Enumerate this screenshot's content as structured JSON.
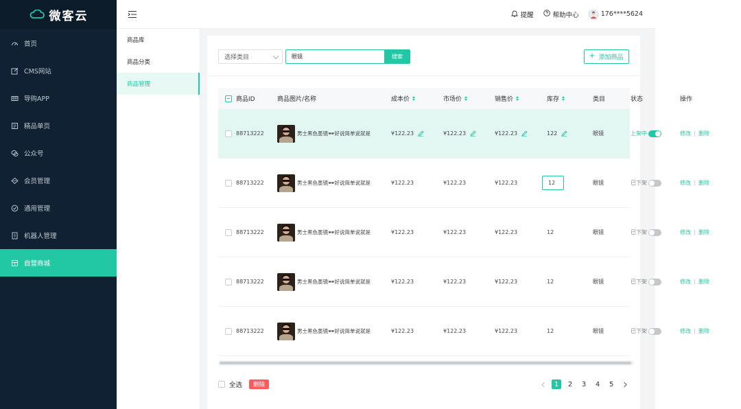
{
  "brand": {
    "name": "微客云"
  },
  "sidebar": {
    "items": [
      {
        "label": "首页",
        "icon": "dashboard-icon"
      },
      {
        "label": "CMS网站",
        "icon": "edit-icon"
      },
      {
        "label": "导购APP",
        "icon": "cart-icon"
      },
      {
        "label": "精品单页",
        "icon": "page-icon"
      },
      {
        "label": "公众号",
        "icon": "wechat-icon"
      },
      {
        "label": "会员管理",
        "icon": "member-icon"
      },
      {
        "label": "通用管理",
        "icon": "check-circle-icon"
      },
      {
        "label": "机器人管理",
        "icon": "robot-icon"
      },
      {
        "label": "自营商城",
        "icon": "shop-icon",
        "active": true
      }
    ]
  },
  "header": {
    "reminder": "提醒",
    "help": "帮助中心",
    "user": "176****5624"
  },
  "submenu": {
    "items": [
      {
        "label": "商品库"
      },
      {
        "label": "商品分类"
      },
      {
        "label": "商品管理",
        "active": true
      }
    ]
  },
  "toolbar": {
    "category_select": "选择类目",
    "search_value": "眼镜",
    "search_button": "搜索",
    "add_button": "添加商品"
  },
  "table": {
    "columns": {
      "id": "商品ID",
      "name": "商品图片/名称",
      "cost": "成本价",
      "market": "市场价",
      "sale": "销售价",
      "stock": "库存",
      "category": "类目",
      "status": "状态",
      "ops": "操作"
    },
    "rows": [
      {
        "id": "88713222",
        "name": "男士黑色墨镜🕶好说简单说就是",
        "cost": "¥122.23",
        "market": "¥122.23",
        "sale": "¥122.23",
        "stock": "122",
        "category": "眼镜",
        "status": "上架中",
        "on": true
      },
      {
        "id": "88713222",
        "name": "男士黑色墨镜🕶好说简单说就是",
        "cost": "¥122.23",
        "market": "¥122.23",
        "sale": "¥122.23",
        "stock": "12",
        "category": "眼镜",
        "status": "已下架",
        "on": false
      },
      {
        "id": "88713222",
        "name": "男士黑色墨镜🕶好说简单说就是",
        "cost": "¥122.23",
        "market": "¥122.23",
        "sale": "¥122.23",
        "stock": "12",
        "category": "眼镜",
        "status": "已下架",
        "on": false
      },
      {
        "id": "88713222",
        "name": "男士黑色墨镜🕶好说简单说就是",
        "cost": "¥122.23",
        "market": "¥122.23",
        "sale": "¥122.23",
        "stock": "12",
        "category": "眼镜",
        "status": "已下架",
        "on": false
      },
      {
        "id": "88713222",
        "name": "男士黑色墨镜🕶好说简单说就是",
        "cost": "¥122.23",
        "market": "¥122.23",
        "sale": "¥122.23",
        "stock": "12",
        "category": "眼镜",
        "status": "已下架",
        "on": false
      }
    ],
    "op_edit": "修改",
    "op_delete": "删除"
  },
  "footer": {
    "select_all": "全选",
    "delete_button": "删除",
    "pages": [
      "1",
      "2",
      "3",
      "4",
      "5"
    ],
    "current_page": "1"
  },
  "colors": {
    "accent": "#22c8a4",
    "sidebar": "#0f2133",
    "danger": "#ff5b5b"
  }
}
